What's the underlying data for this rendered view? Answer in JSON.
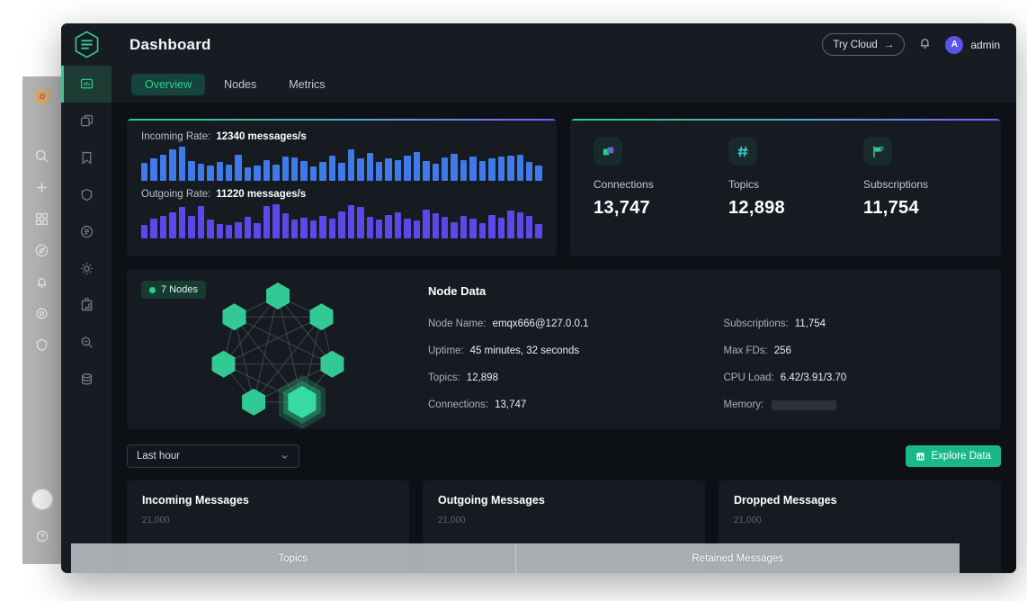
{
  "header": {
    "title": "Dashboard",
    "try_cloud_label": "Try Cloud",
    "try_cloud_arrow": "→",
    "user_initial": "A",
    "user_name": "admin",
    "logo_icon": "emqx-hexagon-logo",
    "bell_icon": "notification-bell-icon"
  },
  "tabs": [
    {
      "label": "Overview",
      "active": true
    },
    {
      "label": "Nodes",
      "active": false
    },
    {
      "label": "Metrics",
      "active": false
    }
  ],
  "sidebar": {
    "items": [
      {
        "icon": "dashboard-icon",
        "name": "dashboard",
        "active": true
      },
      {
        "icon": "clients-icon",
        "name": "clients",
        "active": false
      },
      {
        "icon": "bookmark-icon",
        "name": "topics",
        "active": false
      },
      {
        "icon": "shield-icon",
        "name": "access-control",
        "active": false
      },
      {
        "icon": "rules-icon",
        "name": "rule-engine",
        "active": false
      },
      {
        "icon": "gear-icon",
        "name": "configuration",
        "active": false
      },
      {
        "icon": "plugin-icon",
        "name": "extensions",
        "active": false
      },
      {
        "icon": "diagnose-icon",
        "name": "diagnose",
        "active": false
      },
      {
        "icon": "database-icon",
        "name": "data-integration",
        "active": false
      }
    ]
  },
  "grafana_rail": {
    "items": [
      {
        "icon": "grafana-logo-icon",
        "name": "grafana-logo"
      },
      {
        "icon": "search-icon",
        "name": "search"
      },
      {
        "icon": "plus-icon",
        "name": "create"
      },
      {
        "icon": "dashboards-grid-icon",
        "name": "dashboards"
      },
      {
        "icon": "compass-icon",
        "name": "explore"
      },
      {
        "icon": "bell-icon",
        "name": "alerting"
      },
      {
        "icon": "gear-icon",
        "name": "configuration"
      },
      {
        "icon": "shield-icon",
        "name": "server-admin"
      }
    ],
    "avatar_icon": "user-avatar-icon",
    "help_icon": "help-question-icon"
  },
  "rates": {
    "incoming_label": "Incoming Rate:",
    "incoming_value": "12340 messages/s",
    "outgoing_label": "Outgoing Rate:",
    "outgoing_value": "11220 messages/s"
  },
  "stats": [
    {
      "icon": "connections-icon",
      "label": "Connections",
      "value": "13,747"
    },
    {
      "icon": "hash-topics-icon",
      "label": "Topics",
      "value": "12,898"
    },
    {
      "icon": "subscriptions-flag-icon",
      "label": "Subscriptions",
      "value": "11,754"
    }
  ],
  "nodes_panel": {
    "badge_label": "7 Nodes",
    "node_count": 7,
    "highlighted_node_index": 3,
    "title": "Node Data",
    "left_rows": [
      {
        "label": "Node Name:",
        "value": "emqx666@127.0.0.1"
      },
      {
        "label": "Uptime:",
        "value": "45 minutes, 32 seconds"
      },
      {
        "label": "Topics:",
        "value": "12,898"
      },
      {
        "label": "Connections:",
        "value": "13,747"
      }
    ],
    "right_rows": [
      {
        "label": "Subscriptions:",
        "value": "11,754"
      },
      {
        "label": "Max FDs:",
        "value": "256"
      },
      {
        "label": "CPU Load:",
        "value": "6.42/3.91/3.70"
      },
      {
        "label": "Memory:",
        "value": "",
        "bar_percent": 66
      }
    ]
  },
  "toolbar": {
    "range_selected": "Last hour",
    "chevron_icon": "chevron-down-icon",
    "explore_label": "Explore Data",
    "explore_icon": "chart-icon"
  },
  "bottom_cards": [
    {
      "title": "Incoming Messages",
      "axis_top": "21,000"
    },
    {
      "title": "Outgoing Messages",
      "axis_top": "21,000"
    },
    {
      "title": "Dropped Messages",
      "axis_top": "21,000"
    }
  ],
  "overlay_strip": {
    "cells": [
      "Topics",
      "Retained Messages"
    ]
  },
  "colors": {
    "accent_green": "#2ecc8f",
    "incoming_bar": "#4079e8",
    "outgoing_bar": "#5b48e8",
    "gradient_from": "#2ecc8f",
    "gradient_to": "#7c5cfc",
    "panel_bg": "#161b22",
    "window_bg": "#0d1116"
  },
  "chart_data": [
    {
      "type": "bar",
      "title": "Incoming Rate",
      "ylabel": "messages/s",
      "values": [
        18,
        22,
        26,
        31,
        34,
        20,
        17,
        15,
        19,
        16,
        26,
        13,
        15,
        21,
        16,
        24,
        23,
        20,
        14,
        19,
        25,
        18,
        31,
        22,
        28,
        19,
        22,
        21,
        25,
        29,
        20,
        17,
        23,
        27,
        21,
        24,
        20,
        22,
        24,
        25,
        26,
        19,
        15
      ],
      "color": "#4079e8"
    },
    {
      "type": "bar",
      "title": "Outgoing Rate",
      "ylabel": "messages/s",
      "values": [
        13,
        19,
        22,
        25,
        30,
        22,
        31,
        18,
        14,
        13,
        16,
        21,
        15,
        31,
        33,
        24,
        18,
        20,
        17,
        22,
        19,
        26,
        32,
        30,
        21,
        18,
        23,
        25,
        19,
        17,
        28,
        24,
        21,
        16,
        22,
        19,
        15,
        23,
        20,
        27,
        25,
        22,
        14
      ],
      "color": "#5b48e8"
    },
    {
      "type": "line",
      "title": "Incoming Messages",
      "ylabel": "messages",
      "ymax": "21,000",
      "x": [
        "Last hour"
      ],
      "values": []
    },
    {
      "type": "line",
      "title": "Outgoing Messages",
      "ylabel": "messages",
      "ymax": "21,000",
      "x": [
        "Last hour"
      ],
      "values": []
    },
    {
      "type": "line",
      "title": "Dropped Messages",
      "ylabel": "messages",
      "ymax": "21,000",
      "x": [
        "Last hour"
      ],
      "values": []
    }
  ]
}
